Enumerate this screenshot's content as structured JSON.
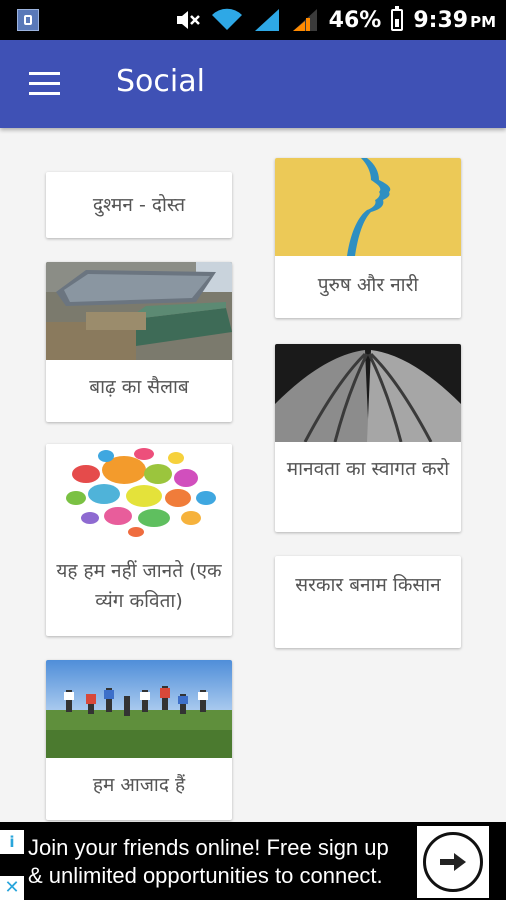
{
  "status_bar": {
    "battery": "46%",
    "time": "9:39",
    "ampm": "PM",
    "icons": [
      "app-notification-icon",
      "mute-icon",
      "wifi-icon",
      "signal-icon",
      "signal-icon-2",
      "battery-icon"
    ]
  },
  "app_bar": {
    "title": "Social",
    "menu_icon": "hamburger-menu-icon",
    "color": "#3f51b5"
  },
  "cards": [
    {
      "label": "दुश्मन - दोस्त",
      "image": "none"
    },
    {
      "label": "पुरुष और नारी",
      "image": "face-profile-illustration"
    },
    {
      "label": "बाढ़ का सैलाब",
      "image": "flood-photo"
    },
    {
      "label": "मानवता का स्वागत करो",
      "image": "praying-hands-photo"
    },
    {
      "label": "यह हम नहीं जानते (एक व्यंग कविता)",
      "image": "speech-bubbles-illustration"
    },
    {
      "label": "सरकार बनाम किसान",
      "image": "none"
    },
    {
      "label": "हम आजाद हैं",
      "image": "jumping-people-photo"
    }
  ],
  "ad": {
    "text_line1": "Join your friends online! Free sign up",
    "text_line2": "& unlimited opportunities to connect.",
    "info_icon": "i",
    "close_icon": "✕"
  }
}
